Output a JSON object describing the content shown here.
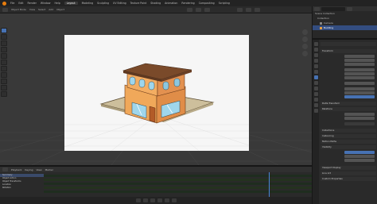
{
  "menubar": {
    "items": [
      "File",
      "Edit",
      "Render",
      "Window",
      "Help"
    ],
    "workspaces": [
      "Layout",
      "Modeling",
      "Sculpting",
      "UV Editing",
      "Texture Paint",
      "Shading",
      "Animation",
      "Rendering",
      "Compositing",
      "Scripting"
    ],
    "active_workspace": "Layout"
  },
  "viewport": {
    "header_items": [
      "Object Mode",
      "View",
      "Select",
      "Add",
      "Object"
    ],
    "overlay_label": "",
    "colors": {
      "background": "#393939",
      "canvas": "#f6f6f6",
      "grid": "#4a4a4a"
    }
  },
  "outliner": {
    "rows": [
      {
        "label": "Scene Collection"
      },
      {
        "label": "Collection"
      },
      {
        "label": "Camera"
      },
      {
        "label": "Building"
      }
    ],
    "selected_index": 3
  },
  "properties": {
    "panels": [
      "Transform",
      "Delta Transform",
      "Relations",
      "Collections",
      "Instancing",
      "Motion Paths",
      "Visibility",
      "Viewport Display",
      "Line Art",
      "Custom Properties"
    ]
  },
  "timeline": {
    "header_items": [
      "Playback",
      "Keying",
      "View",
      "Marker"
    ],
    "tracks": [
      "Summary",
      "Object Action",
      "Object Transforms",
      "Location",
      "Rotation"
    ]
  },
  "colors": {
    "accent": "#4772b3",
    "playhead": "#4a86d8",
    "roof": "#7a4a2a",
    "wall": "#e89a50",
    "glass": "#9fd6ec"
  }
}
